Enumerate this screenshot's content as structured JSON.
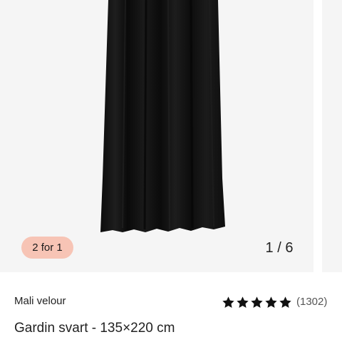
{
  "gallery": {
    "badge_text": "2 for 1",
    "counter_text": "1 / 6",
    "image_subject": "black velour curtain",
    "colors": {
      "background": "#f5f5f5",
      "curtain": "#111111",
      "badge_bg": "#f7c4b5"
    }
  },
  "product": {
    "brand": "Mali velour",
    "title": "Gardin svart - 135×220 cm",
    "rating": {
      "stars": 5,
      "max_stars": 5,
      "count_text": "(1302)",
      "icon": "star-icon"
    }
  }
}
